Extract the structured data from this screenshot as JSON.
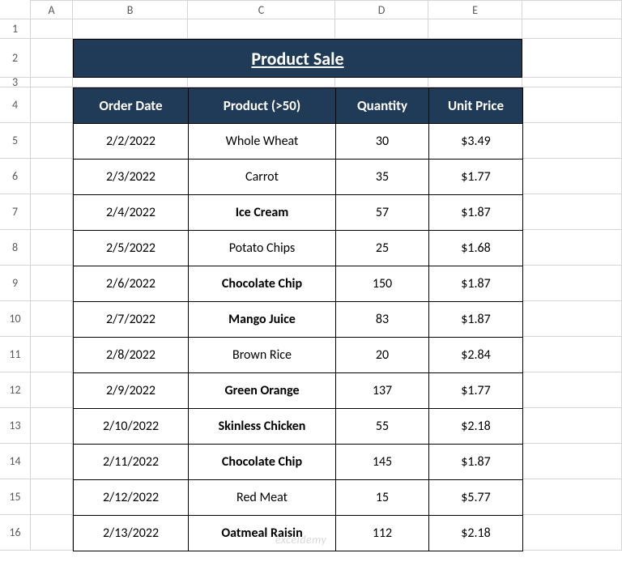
{
  "columns": [
    "A",
    "B",
    "C",
    "D",
    "E"
  ],
  "rowCount": 16,
  "title": "Product Sale",
  "headers": {
    "orderDate": "Order Date",
    "product": "Product (>50)",
    "quantity": "Quantity",
    "unitPrice": "Unit Price"
  },
  "rows": [
    {
      "date": "2/2/2022",
      "product": "Whole Wheat",
      "qty": "30",
      "price": "$3.49",
      "bold": false
    },
    {
      "date": "2/3/2022",
      "product": "Carrot",
      "qty": "35",
      "price": "$1.77",
      "bold": false
    },
    {
      "date": "2/4/2022",
      "product": "Ice Cream",
      "qty": "57",
      "price": "$1.87",
      "bold": true
    },
    {
      "date": "2/5/2022",
      "product": "Potato Chips",
      "qty": "25",
      "price": "$1.68",
      "bold": false
    },
    {
      "date": "2/6/2022",
      "product": "Chocolate Chip",
      "qty": "150",
      "price": "$1.87",
      "bold": true
    },
    {
      "date": "2/7/2022",
      "product": "Mango Juice",
      "qty": "83",
      "price": "$1.87",
      "bold": true
    },
    {
      "date": "2/8/2022",
      "product": "Brown Rice",
      "qty": "20",
      "price": "$2.84",
      "bold": false
    },
    {
      "date": "2/9/2022",
      "product": "Green Orange",
      "qty": "137",
      "price": "$1.77",
      "bold": true
    },
    {
      "date": "2/10/2022",
      "product": "Skinless Chicken",
      "qty": "55",
      "price": "$2.18",
      "bold": true
    },
    {
      "date": "2/11/2022",
      "product": "Chocolate Chip",
      "qty": "145",
      "price": "$1.87",
      "bold": true
    },
    {
      "date": "2/12/2022",
      "product": "Red Meat",
      "qty": "15",
      "price": "$5.77",
      "bold": false
    },
    {
      "date": "2/13/2022",
      "product": "Oatmeal Raisin",
      "qty": "112",
      "price": "$2.18",
      "bold": true
    }
  ],
  "watermark": "exceldemy"
}
